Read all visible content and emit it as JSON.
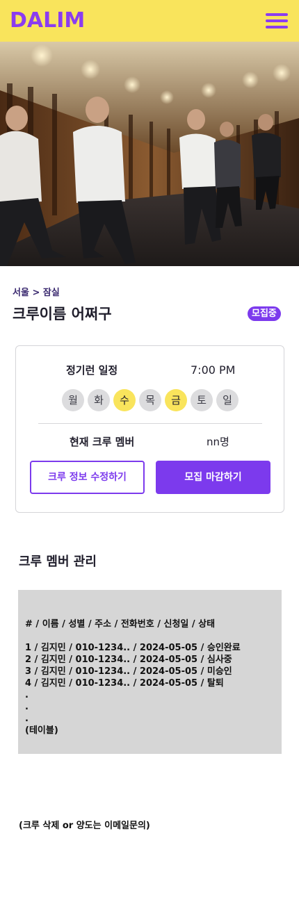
{
  "header": {
    "logo": "DALIM",
    "menu_icon": "hamburger-menu-icon",
    "background_color": "#f9e45c",
    "brand_color": "#8b3cf0"
  },
  "hero": {
    "alt": "Runners jogging through a lit tunnel"
  },
  "crew": {
    "breadcrumb": "서울 > 잠실",
    "name": "크루이름 어쩌구",
    "status": "모집중"
  },
  "schedule": {
    "label": "정기런 일정",
    "time": "7:00 PM",
    "days": [
      {
        "label": "월",
        "active": false
      },
      {
        "label": "화",
        "active": false
      },
      {
        "label": "수",
        "active": true
      },
      {
        "label": "목",
        "active": false
      },
      {
        "label": "금",
        "active": true
      },
      {
        "label": "토",
        "active": false
      },
      {
        "label": "일",
        "active": false
      }
    ]
  },
  "members": {
    "label": "현재 크루 멤버",
    "count": "nn명"
  },
  "actions": {
    "edit_label": "크루 정보 수정하기",
    "close_label": "모집 마감하기"
  },
  "management": {
    "title": "크루 멤버 관리",
    "header": "# / 이름 / 성별 / 주소 / 전화번호 / 신청일  / 상태",
    "rows": [
      "1 / 김지민 / 010-1234.. / 2024-05-05 / 승인완료",
      "2 / 김지민 / 010-1234.. / 2024-05-05 / 심사중",
      "3 / 김지민 / 010-1234.. / 2024-05-05 / 미승인",
      "4 / 김지민 / 010-1234.. / 2024-05-05 / 탈퇴",
      ".",
      ".",
      "."
    ],
    "note": "(테이블)"
  },
  "footer": {
    "note": "(크루 삭제 or 양도는 이메일문의)"
  }
}
